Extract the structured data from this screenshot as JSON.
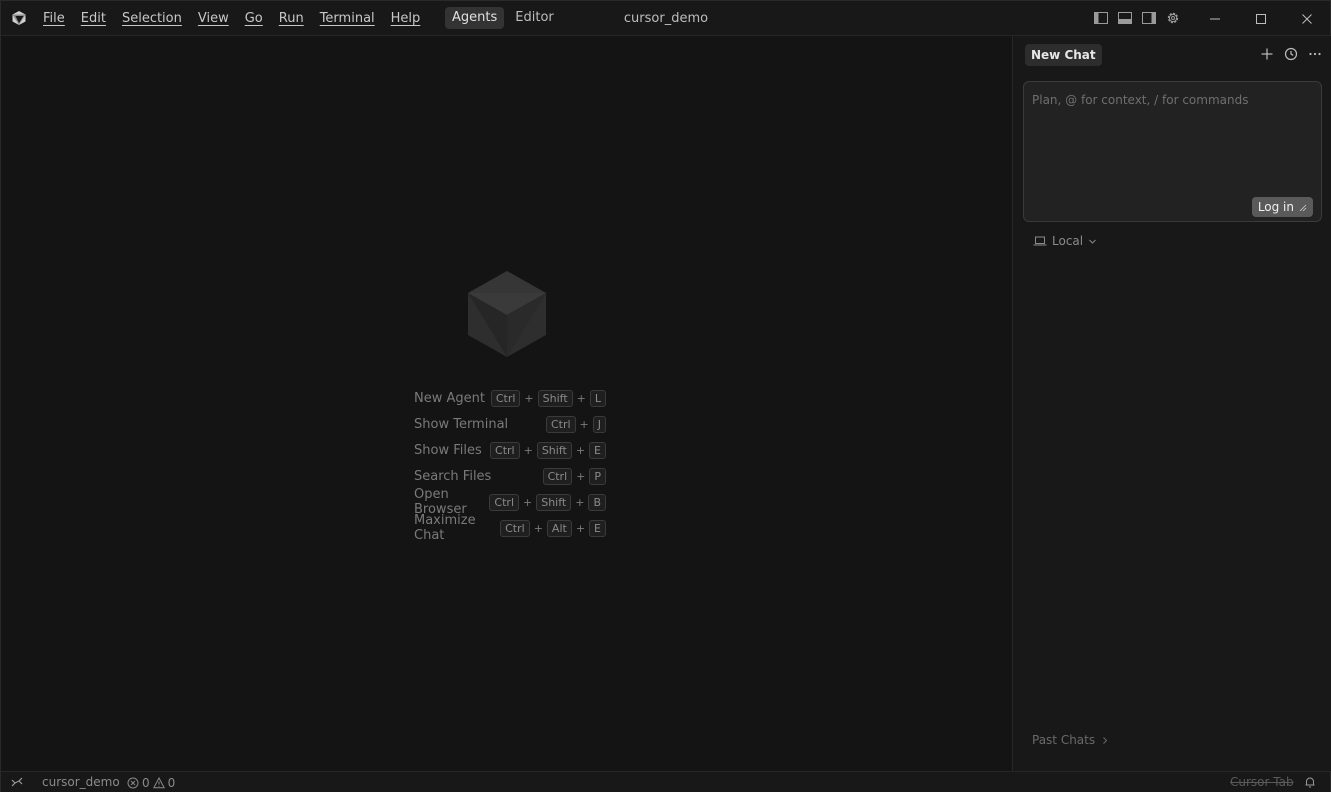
{
  "titlebar": {
    "menu": [
      "File",
      "Edit",
      "Selection",
      "View",
      "Go",
      "Run",
      "Terminal",
      "Help"
    ],
    "modes": [
      {
        "label": "Agents",
        "active": true
      },
      {
        "label": "Editor",
        "active": false
      }
    ],
    "window_title": "cursor_demo",
    "icons": [
      "toggle-primary-sidebar-icon",
      "toggle-panel-icon",
      "toggle-secondary-sidebar-icon",
      "settings-gear-icon"
    ],
    "window_controls": [
      "minimize-icon",
      "maximize-icon",
      "close-icon"
    ]
  },
  "main": {
    "shortcuts": [
      {
        "label": "New Agent",
        "keys": [
          "Ctrl",
          "Shift",
          "L"
        ]
      },
      {
        "label": "Show Terminal",
        "keys": [
          "Ctrl",
          "J"
        ]
      },
      {
        "label": "Show Files",
        "keys": [
          "Ctrl",
          "Shift",
          "E"
        ]
      },
      {
        "label": "Search Files",
        "keys": [
          "Ctrl",
          "P"
        ]
      },
      {
        "label": "Open Browser",
        "keys": [
          "Ctrl",
          "Shift",
          "B"
        ]
      },
      {
        "label": "Maximize Chat",
        "keys": [
          "Ctrl",
          "Alt",
          "E"
        ]
      }
    ]
  },
  "panel": {
    "tab_label": "New Chat",
    "composer": {
      "value": "",
      "placeholder": "Plan, @ for context, / for commands"
    },
    "login_label": "Log in",
    "environment_label": "Local",
    "past_chats_label": "Past Chats"
  },
  "statusbar": {
    "folder": "cursor_demo",
    "errors": "0",
    "warnings": "0",
    "cursor_tab": "Cursor Tab"
  },
  "colors": {
    "background": "#141414",
    "chrome": "#181818",
    "active_mode": "#333333",
    "login_button": "#5a5a5a"
  }
}
